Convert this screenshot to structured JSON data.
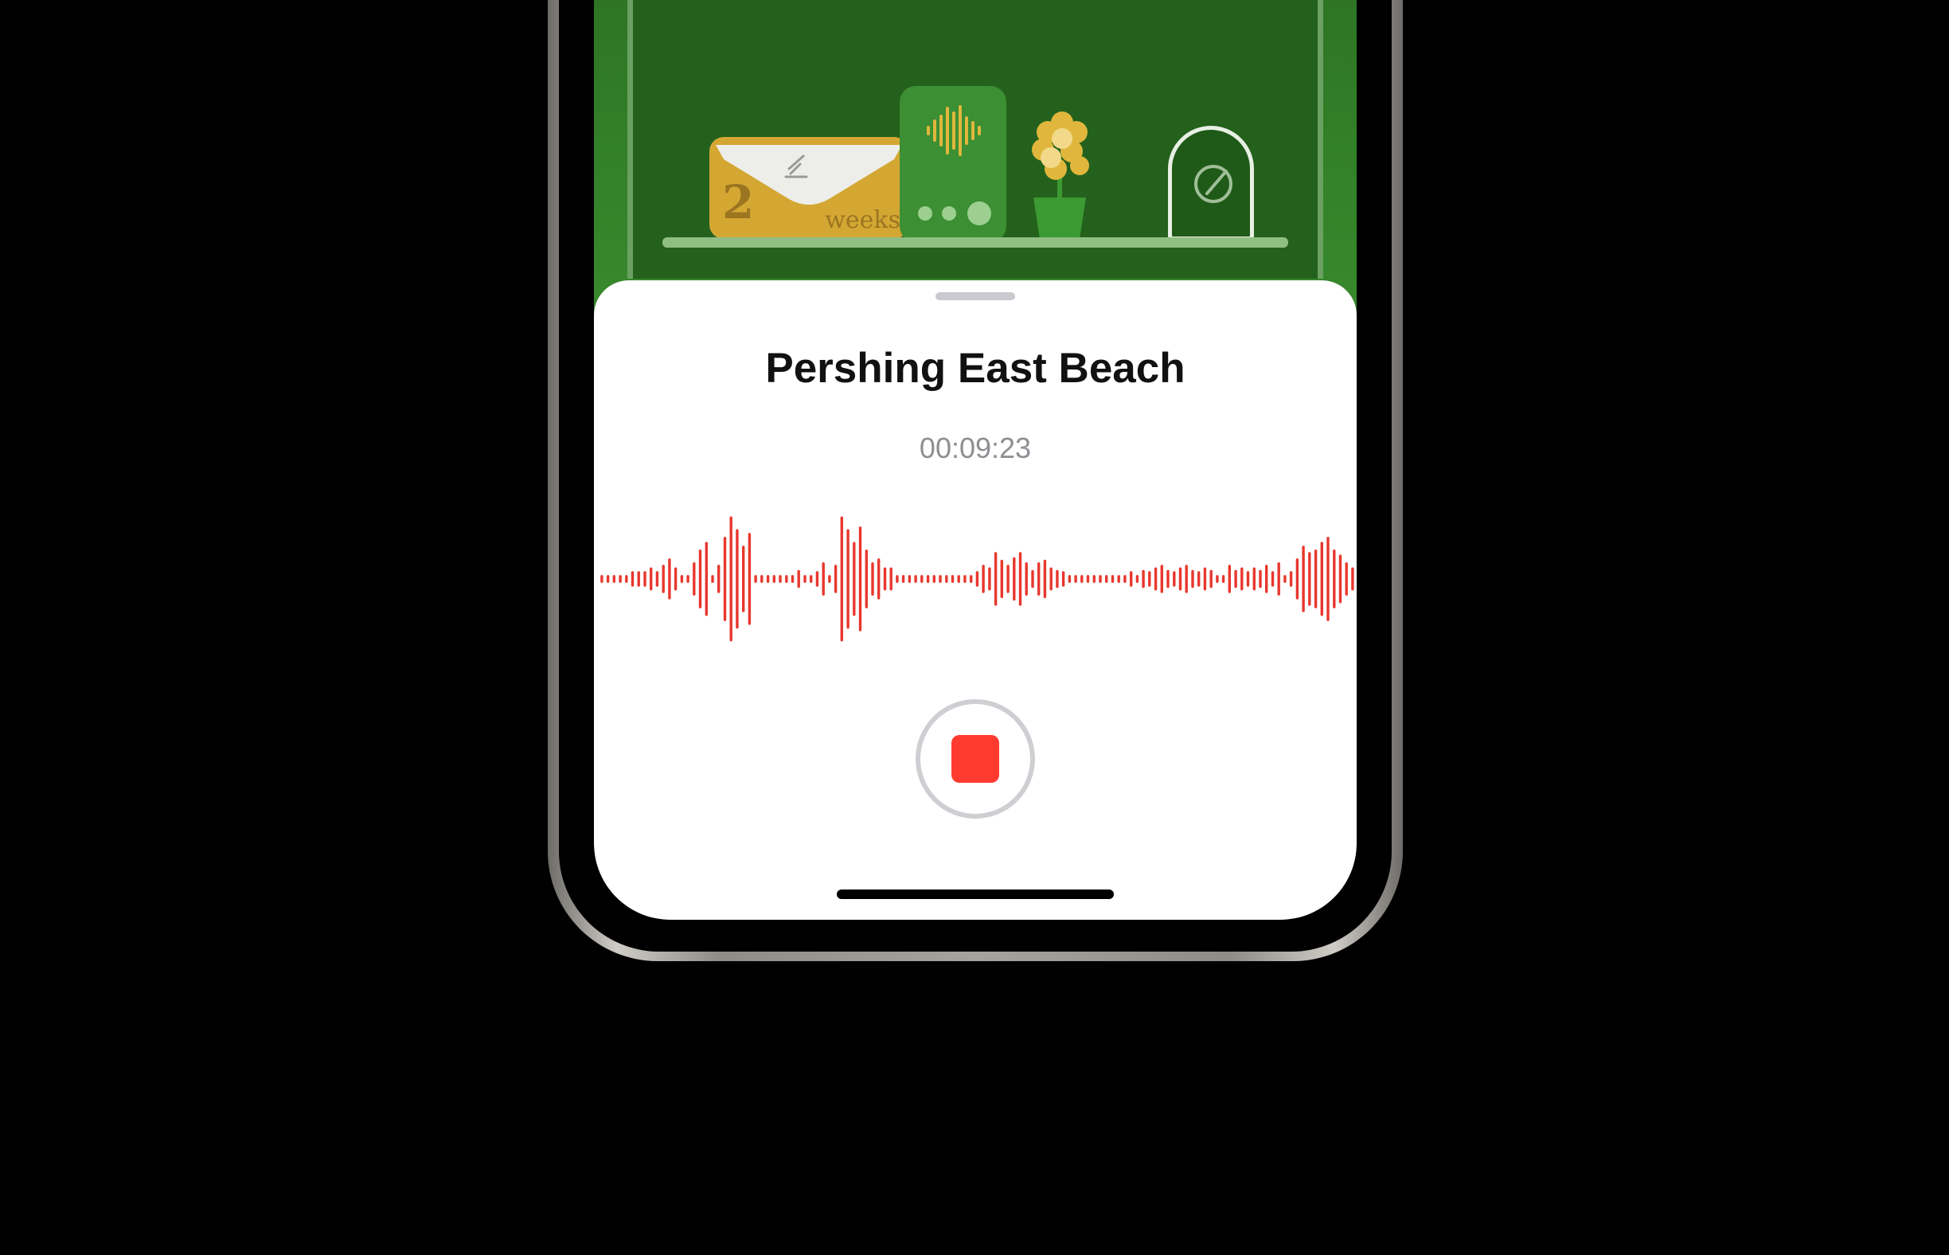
{
  "background_scene": {
    "envelope_number": "2",
    "envelope_label": "weeks",
    "icons": [
      "envelope-pencil-icon",
      "voice-memo-widget",
      "flower-pot-icon",
      "compose-arch-icon"
    ]
  },
  "sheet": {
    "title": "Pershing East Beach",
    "elapsed_time": "00:09:23",
    "record_button": "stop-icon"
  },
  "colors": {
    "accent_red": "#ff3b30",
    "waveform": "#e8372d",
    "scene_green": "#2b7a23",
    "gold": "#d4a733"
  },
  "waveform": {
    "levels": [
      0.02,
      0.02,
      0.02,
      0.02,
      0.02,
      0.05,
      0.05,
      0.05,
      0.08,
      0.05,
      0.1,
      0.15,
      0.08,
      0.02,
      0.02,
      0.12,
      0.22,
      0.28,
      0.02,
      0.1,
      0.32,
      0.48,
      0.38,
      0.25,
      0.35,
      0.02,
      0.02,
      0.02,
      0.02,
      0.02,
      0.02,
      0.02,
      0.06,
      0.02,
      0.02,
      0.05,
      0.12,
      0.02,
      0.1,
      0.48,
      0.38,
      0.28,
      0.4,
      0.22,
      0.12,
      0.15,
      0.08,
      0.08,
      0.02,
      0.02,
      0.02,
      0.02,
      0.02,
      0.02,
      0.02,
      0.02,
      0.02,
      0.02,
      0.02,
      0.02,
      0.02,
      0.05,
      0.1,
      0.08,
      0.2,
      0.14,
      0.1,
      0.16,
      0.2,
      0.12,
      0.06,
      0.12,
      0.14,
      0.08,
      0.06,
      0.05,
      0.02,
      0.02,
      0.02,
      0.02,
      0.02,
      0.02,
      0.02,
      0.02,
      0.02,
      0.02,
      0.05,
      0.02,
      0.06,
      0.05,
      0.08,
      0.1,
      0.06,
      0.05,
      0.08,
      0.1,
      0.06,
      0.05,
      0.08,
      0.06,
      0.02,
      0.02,
      0.1,
      0.06,
      0.08,
      0.05,
      0.08,
      0.06,
      0.1,
      0.05,
      0.12,
      0.02,
      0.05,
      0.15,
      0.25,
      0.2,
      0.22,
      0.28,
      0.32,
      0.22,
      0.18,
      0.12,
      0.08,
      0.05,
      0.02,
      0.05
    ]
  }
}
